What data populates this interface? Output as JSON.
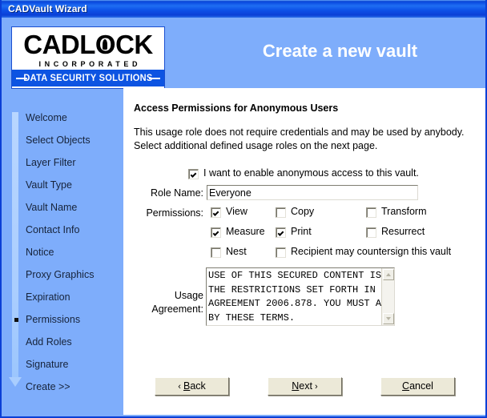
{
  "window": {
    "title": "CADVault Wizard"
  },
  "header": {
    "title": "Create a new vault",
    "logo": {
      "word_before": "CADL",
      "word_o": "O",
      "word_after": "CK",
      "incorporated": "INCORPORATED",
      "tagline": "DATA SECURITY SOLUTIONS"
    }
  },
  "sidebar": {
    "items": [
      {
        "label": "Welcome",
        "current": false
      },
      {
        "label": "Select Objects",
        "current": false
      },
      {
        "label": "Layer Filter",
        "current": false
      },
      {
        "label": "Vault Type",
        "current": false
      },
      {
        "label": "Vault Name",
        "current": false
      },
      {
        "label": "Contact Info",
        "current": false
      },
      {
        "label": "Notice",
        "current": false
      },
      {
        "label": "Proxy Graphics",
        "current": false
      },
      {
        "label": "Expiration",
        "current": false
      },
      {
        "label": "Permissions",
        "current": true
      },
      {
        "label": "Add Roles",
        "current": false
      },
      {
        "label": "Signature",
        "current": false
      },
      {
        "label": "Create >>",
        "current": false
      }
    ]
  },
  "main": {
    "heading": "Access Permissions for Anonymous Users",
    "description": "This usage role does not require credentials and may be used by anybody. Select additional defined usage roles on the next page.",
    "anonymous_checkbox": {
      "label": "I want to enable anonymous access to this vault.",
      "checked": true
    },
    "role_name": {
      "label": "Role Name:",
      "value": "Everyone"
    },
    "permissions": {
      "label": "Permissions:",
      "options": [
        {
          "label": "View",
          "checked": true
        },
        {
          "label": "Copy",
          "checked": false
        },
        {
          "label": "Transform",
          "checked": false
        },
        {
          "label": "Measure",
          "checked": true
        },
        {
          "label": "Print",
          "checked": true
        },
        {
          "label": "Resurrect",
          "checked": false
        },
        {
          "label": "Nest",
          "checked": false
        },
        {
          "label": "Recipient may countersign this vault",
          "checked": false
        }
      ]
    },
    "usage_agreement": {
      "label_line1": "Usage",
      "label_line2": "Agreement:",
      "value": "USE OF THIS SECURED CONTENT IS SUBJECT TO THE RESTRICTIONS SET FORTH IN OPERATING AGREEMENT 2006.878. YOU MUST AGREE TO ABIDE BY THESE TERMS."
    }
  },
  "footer": {
    "back": {
      "prefix": "‹ ",
      "mnemonic": "B",
      "rest": "ack"
    },
    "next": {
      "mnemonic": "N",
      "rest": "ext",
      "suffix": " ›"
    },
    "cancel": {
      "mnemonic": "C",
      "rest": "ancel"
    }
  },
  "colors": {
    "background_blue": "#7eadfb",
    "title_blue": "#0a49e0",
    "panel_white": "#ffffff",
    "button_face": "#ece9d8"
  }
}
